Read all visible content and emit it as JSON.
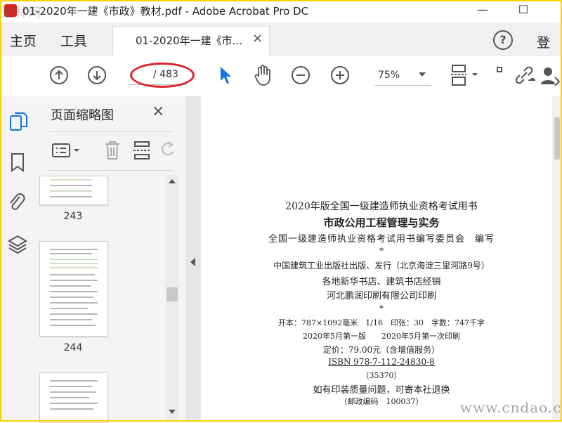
{
  "window": {
    "title": "01-2020年一建《市政》教材.pdf - Adobe Acrobat Pro DC",
    "minimize_glyph": "—",
    "maximize_glyph": "☐",
    "watermark_tl": "速林网"
  },
  "menubar": {
    "home": "主页",
    "tools": "工具",
    "tab_label": "01-2020年一建《市...",
    "tab_close": "×",
    "help_glyph": "?",
    "login": "登录"
  },
  "toolbar": {
    "page_current": "",
    "page_total": "/ 483",
    "zoom": "75%"
  },
  "thumb_panel": {
    "title": "页面缩略图",
    "close": "×",
    "pages": [
      "243",
      "244"
    ]
  },
  "document": {
    "lines": [
      "2020年版全国一级建造师执业资格考试用书",
      "市政公用工程管理与实务",
      "全国一级建造师执业资格考试用书编写委员会　编写",
      "*",
      "中国建筑工业出版社出版、发行（北京海淀三里河路9号）",
      "各地新华书店、建筑书店经销",
      "河北鹏润印刷有限公司印刷",
      "*",
      "开本：787×1092毫米　1/16　印张：30　字数：747千字",
      "2020年5月第一版　　2020年5月第一次印刷",
      "定价：79.00元（含增值服务）",
      "ISBN 978-7-112-24830-8",
      "（35370）",
      "如有印装质量问题，可寄本社退换",
      "（邮政编码　100037）"
    ]
  },
  "watermark_br": "www.cndao.com",
  "colors": {
    "accent_blue": "#1473e6",
    "annotation_red": "#e0222a",
    "frame_yellow": "#f5d300"
  }
}
